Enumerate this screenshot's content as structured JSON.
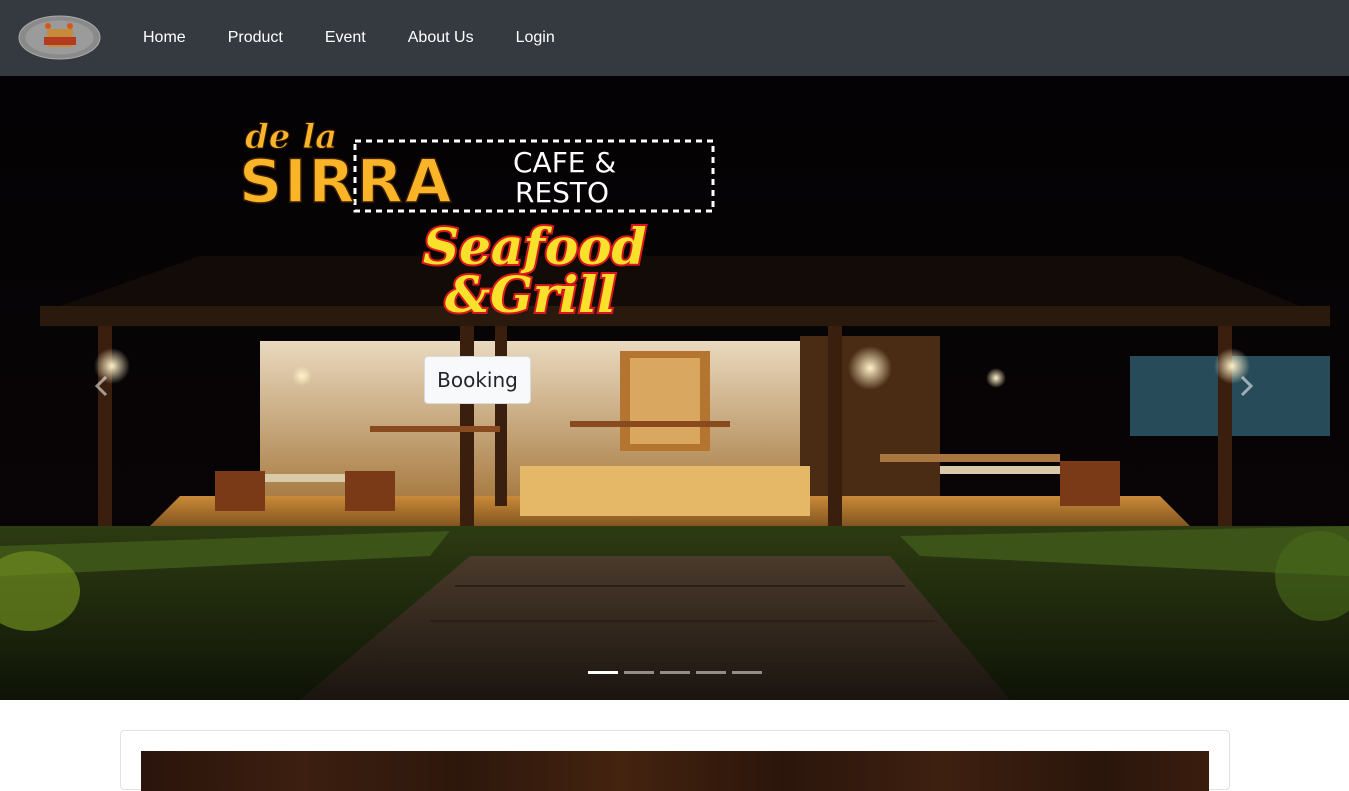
{
  "navbar": {
    "brand_alt": "de la SIRRA logo",
    "links": [
      {
        "label": "Home"
      },
      {
        "label": "Product"
      },
      {
        "label": "Event"
      },
      {
        "label": "About Us"
      },
      {
        "label": "Login"
      }
    ]
  },
  "hero": {
    "logo": {
      "line1": "de la",
      "line2": "SIRRA",
      "line3a": "CAFE &",
      "line3b": "RESTO",
      "tag1": "Seafood",
      "tag2": "&Grill"
    },
    "booking_label": "Booking",
    "prev_icon": "chevron-left-icon",
    "next_icon": "chevron-right-icon",
    "slides_total": 5,
    "active_slide": 1
  },
  "colors": {
    "navbar_bg": "#343a40",
    "logo_yellow": "#f9b428",
    "seafood_red": "#d7191f",
    "seafood_yellow": "#f9e02a"
  }
}
